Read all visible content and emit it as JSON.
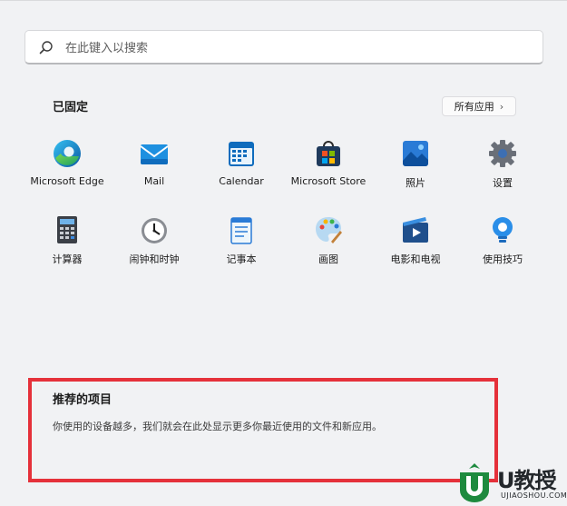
{
  "search": {
    "placeholder": "在此键入以搜索"
  },
  "pinned": {
    "title": "已固定",
    "all_apps_label": "所有应用",
    "apps": [
      {
        "label": "Microsoft Edge",
        "icon": "edge-icon"
      },
      {
        "label": "Mail",
        "icon": "mail-icon"
      },
      {
        "label": "Calendar",
        "icon": "calendar-icon"
      },
      {
        "label": "Microsoft Store",
        "icon": "store-icon"
      },
      {
        "label": "照片",
        "icon": "photos-icon"
      },
      {
        "label": "设置",
        "icon": "settings-icon"
      },
      {
        "label": "计算器",
        "icon": "calculator-icon"
      },
      {
        "label": "闹钟和时钟",
        "icon": "alarm-clock-icon"
      },
      {
        "label": "记事本",
        "icon": "notepad-icon"
      },
      {
        "label": "画图",
        "icon": "paint-icon"
      },
      {
        "label": "电影和电视",
        "icon": "movies-tv-icon"
      },
      {
        "label": "使用技巧",
        "icon": "tips-icon"
      }
    ]
  },
  "recommended": {
    "title": "推荐的项目",
    "text": "你使用的设备越多，我们就会在此处显示更多你最近使用的文件和新应用。"
  },
  "watermark": {
    "text": "U教授",
    "sub": "UJIAOSHOU.COM"
  },
  "colors": {
    "highlight_border": "#e5313a",
    "accent": "#0a62c4",
    "background": "#f1f2f4"
  }
}
